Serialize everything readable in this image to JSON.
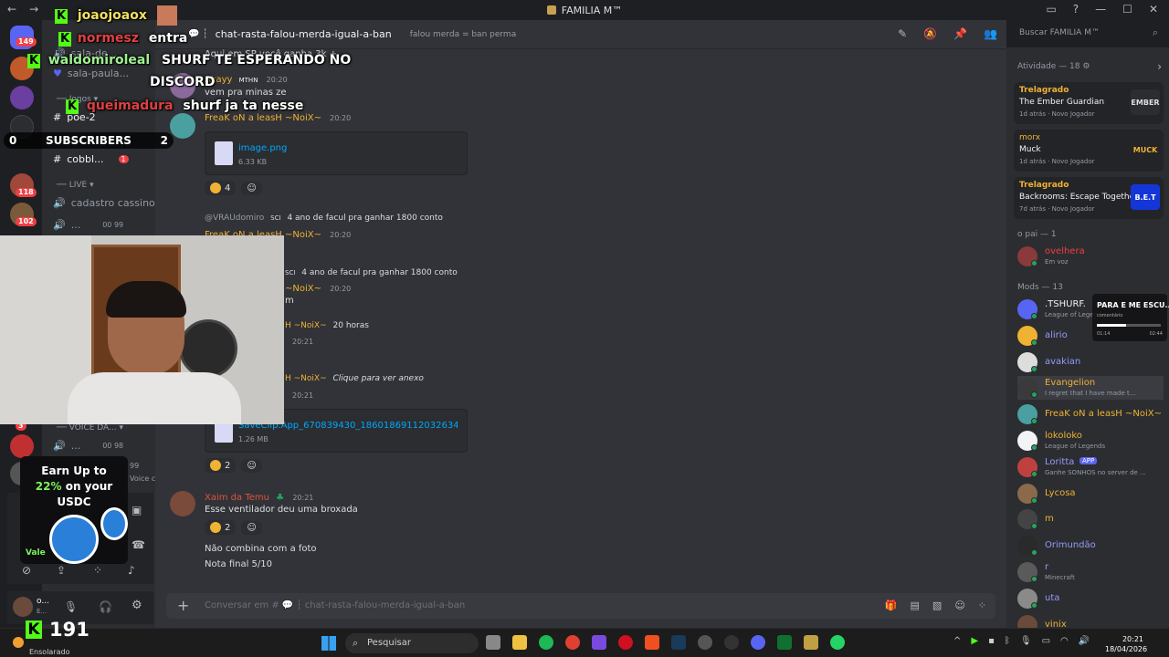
{
  "window": {
    "title": "FAMILIA M™"
  },
  "overlay": {
    "chat": [
      {
        "user": "joaojoaox",
        "text": ""
      },
      {
        "user": "normesz",
        "text": "entra"
      },
      {
        "user": "waldomiroleal",
        "text": "SHURF TE ESPERANDO NO"
      },
      {
        "user": "",
        "text": "DISCORD"
      },
      {
        "user": "queimadura",
        "text": "shurf ja ta nesse"
      }
    ],
    "subscribers": {
      "label": "SUBSCRIBERS",
      "left": "0",
      "right": "2"
    },
    "kick_count": "191",
    "ad": {
      "line1": "Earn Up to",
      "line2_highlight": "22%",
      "line2_rest": " on your",
      "line3": "USDC",
      "cta": "Vale"
    },
    "music": {
      "title": "PARA E ME ESCU...",
      "artist": "comentário",
      "t_start": "01:14",
      "t_end": "02:44",
      "progress": 0.45
    }
  },
  "guilds": {
    "badges": [
      "149",
      "118",
      "102",
      "3"
    ]
  },
  "channels": {
    "items": [
      {
        "name": "sala-de...",
        "icon": "speaker"
      },
      {
        "name": "sala-paula...",
        "icon": "heart"
      },
      {
        "name": "Jogos",
        "icon": "category"
      },
      {
        "name": "poe-2",
        "icon": "hash"
      },
      {
        "name": "cobbl...",
        "icon": "hash",
        "badge": "1"
      },
      {
        "name": "LIVE",
        "icon": "category"
      },
      {
        "name": "cadastro cassino",
        "icon": "speaker"
      },
      {
        "name": "...",
        "icon": "speaker",
        "counts": [
          "00",
          "99"
        ]
      },
      {
        "name": "VOICE DA...",
        "icon": "category"
      },
      {
        "name": "...",
        "icon": "speaker",
        "counts": [
          "00",
          "98"
        ]
      },
      {
        "name": "...",
        "icon": "speaker",
        "counts": [
          "00",
          "99"
        ]
      }
    ],
    "voice_call": "Voice call"
  },
  "user": {
    "name": "o...",
    "status": "E..."
  },
  "chat": {
    "channel_name": "chat-rasta-falou-merda-igual-a-ban",
    "topic": "falou merda = ban perma",
    "composer_placeholder": "Conversar em # 💬 ┆ chat-rasta-falou-merda-igual-a-ban",
    "messages": [
      {
        "kind": "text",
        "text": "Aqui em SP você ganha 3k +"
      },
      {
        "kind": "author",
        "name": "Akayy",
        "tag": "MTHN",
        "time": "20:20",
        "color": "#f0b232"
      },
      {
        "kind": "text",
        "text": "vem pra minas ze"
      },
      {
        "kind": "author",
        "name": "FreaK oN a leasH ~NoiX~",
        "time": "20:20",
        "color": "#f0b232"
      },
      {
        "kind": "attachment",
        "name": "image.png",
        "size": "6.33 KB"
      },
      {
        "kind": "reaction",
        "count": "4"
      },
      {
        "kind": "reply",
        "user": "@VRAUdomiro",
        "tag": "SCI",
        "text": "4 ano de facul pra ganhar 1800 conto"
      },
      {
        "kind": "author",
        "name": "FreaK oN a leasH ~NoiX~",
        "time": "20:20",
        "color": "#f0b232"
      },
      {
        "kind": "reply",
        "user": "",
        "tag": "SCI",
        "text": "4 ano de facul pra ganhar 1800 conto"
      },
      {
        "kind": "author",
        "name": "~NoiX~",
        "time": "20:20",
        "color": "#f0b232"
      },
      {
        "kind": "text",
        "text": "m"
      },
      {
        "kind": "reply",
        "user": "H ~NoiX~",
        "tag": "",
        "text": "20 horas"
      },
      {
        "kind": "time",
        "time": "20:21"
      },
      {
        "kind": "reply",
        "user": "H ~NoiX~",
        "tag": "",
        "text": "Clique para ver anexo"
      },
      {
        "kind": "time",
        "time": "20:21"
      },
      {
        "kind": "attachment",
        "name": "SaveClip.App_670839430_18601869112032634_82...",
        "size": "1.26 MB"
      },
      {
        "kind": "reaction",
        "count": "2"
      },
      {
        "kind": "author",
        "name": "Xaim da Temu",
        "time": "20:21",
        "color": "#e0523b"
      },
      {
        "kind": "text",
        "text": "Esse ventilador deu uma broxada"
      },
      {
        "kind": "reaction",
        "count": "2"
      },
      {
        "kind": "text",
        "text": "Não combina com a foto"
      },
      {
        "kind": "text",
        "text": "Nota final 5/10"
      }
    ]
  },
  "members": {
    "search_placeholder": "Buscar FAMILIA M™",
    "activity_header": "Atividade — 18",
    "activities": [
      {
        "name": "Trelagrado",
        "game": "The Ember Guardian",
        "meta": "1d atrás · Novo Jogador",
        "icon": "EMBER",
        "icon_bg": "#2b2d31",
        "icon_fg": "#dbdee1"
      },
      {
        "name": "morx",
        "game": "Muck",
        "meta": "1d atrás · Novo Jogador",
        "icon": "MUCK",
        "icon_bg": "#232428",
        "icon_fg": "#f0b232"
      },
      {
        "name": "Trelagrado",
        "game": "Backrooms: Escape Together",
        "meta": "7d atrás · Novo Jogador",
        "icon": "B.E.T",
        "icon_bg": "#1436d8",
        "icon_fg": "#ffffff"
      }
    ],
    "o_pai_header": "o pai — 1",
    "o_pai": [
      {
        "name": "ovelhera",
        "status": "Em voz",
        "color": "#f23f43"
      }
    ],
    "mods_header": "Mods — 13",
    "mods": [
      {
        "name": ".TSHURF.",
        "status": "League of Legends",
        "color": "#f2f3f5"
      },
      {
        "name": "alirio",
        "status": "",
        "color": "#949cf7"
      },
      {
        "name": "avakian",
        "status": "",
        "color": "#949cf7"
      },
      {
        "name": "Evangelion",
        "status": "I regret that I have made t...",
        "color": "#f0b232"
      },
      {
        "name": "FreaK oN a leasH ~NoiX~",
        "status": "",
        "color": "#f0b232"
      },
      {
        "name": "lokoloko",
        "status": "League of Legends",
        "color": "#f0b232"
      },
      {
        "name": "Loritta",
        "status": "Ganhe SONHOS no server de ...",
        "color": "#949cf7",
        "badge": "APP"
      },
      {
        "name": "Lycosa",
        "status": "",
        "color": "#f0b232"
      },
      {
        "name": "m",
        "status": "",
        "color": "#f0b232"
      },
      {
        "name": "Orimundão",
        "status": "",
        "color": "#949cf7"
      },
      {
        "name": "r",
        "status": "Minecraft",
        "color": "#949cf7"
      },
      {
        "name": "uta",
        "status": "",
        "color": "#949cf7"
      },
      {
        "name": "vinix",
        "status": "",
        "color": "#f0b232"
      }
    ]
  },
  "taskbar": {
    "search": "Pesquisar",
    "weather": "Ensolarado",
    "time": "20:21",
    "date": "18/04/2026"
  }
}
